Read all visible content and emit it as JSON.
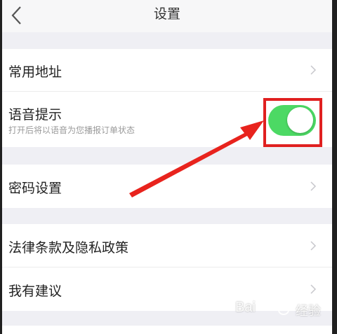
{
  "header": {
    "title": "设置"
  },
  "settings": {
    "common_address": "常用地址",
    "voice_prompt": "语音提示",
    "voice_prompt_desc": "打开后将以语音为您播报订单状态",
    "voice_prompt_enabled": true,
    "password_settings": "密码设置",
    "legal_privacy": "法律条款及隐私政策",
    "suggestions": "我有建议"
  },
  "colors": {
    "toggle_on": "#4cd964",
    "annotation_red": "#e02020",
    "background": "#efeff4"
  },
  "watermark": {
    "brand": "Bai",
    "brand_suffix": "经验"
  }
}
